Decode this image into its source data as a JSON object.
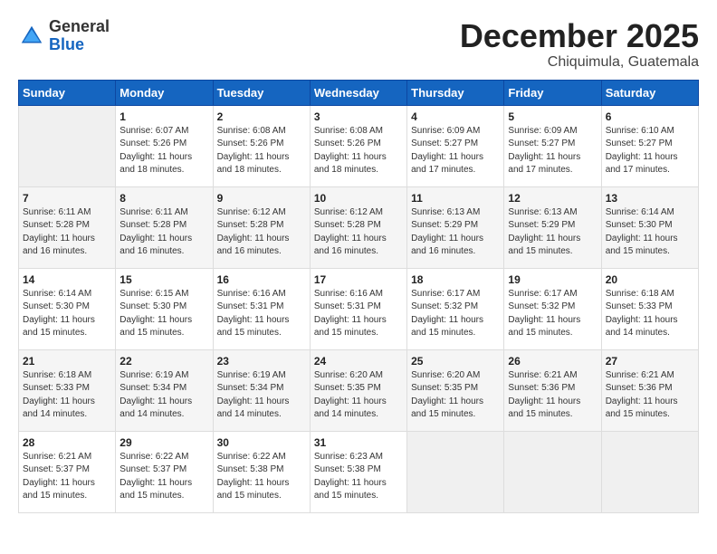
{
  "header": {
    "logo_general": "General",
    "logo_blue": "Blue",
    "month_title": "December 2025",
    "location": "Chiquimula, Guatemala"
  },
  "days_of_week": [
    "Sunday",
    "Monday",
    "Tuesday",
    "Wednesday",
    "Thursday",
    "Friday",
    "Saturday"
  ],
  "weeks": [
    [
      {
        "day": "",
        "empty": true
      },
      {
        "day": "1",
        "sunrise": "6:07 AM",
        "sunset": "5:26 PM",
        "daylight": "11 hours and 18 minutes."
      },
      {
        "day": "2",
        "sunrise": "6:08 AM",
        "sunset": "5:26 PM",
        "daylight": "11 hours and 18 minutes."
      },
      {
        "day": "3",
        "sunrise": "6:08 AM",
        "sunset": "5:26 PM",
        "daylight": "11 hours and 18 minutes."
      },
      {
        "day": "4",
        "sunrise": "6:09 AM",
        "sunset": "5:27 PM",
        "daylight": "11 hours and 17 minutes."
      },
      {
        "day": "5",
        "sunrise": "6:09 AM",
        "sunset": "5:27 PM",
        "daylight": "11 hours and 17 minutes."
      },
      {
        "day": "6",
        "sunrise": "6:10 AM",
        "sunset": "5:27 PM",
        "daylight": "11 hours and 17 minutes."
      }
    ],
    [
      {
        "day": "7",
        "sunrise": "6:11 AM",
        "sunset": "5:28 PM",
        "daylight": "11 hours and 16 minutes."
      },
      {
        "day": "8",
        "sunrise": "6:11 AM",
        "sunset": "5:28 PM",
        "daylight": "11 hours and 16 minutes."
      },
      {
        "day": "9",
        "sunrise": "6:12 AM",
        "sunset": "5:28 PM",
        "daylight": "11 hours and 16 minutes."
      },
      {
        "day": "10",
        "sunrise": "6:12 AM",
        "sunset": "5:28 PM",
        "daylight": "11 hours and 16 minutes."
      },
      {
        "day": "11",
        "sunrise": "6:13 AM",
        "sunset": "5:29 PM",
        "daylight": "11 hours and 16 minutes."
      },
      {
        "day": "12",
        "sunrise": "6:13 AM",
        "sunset": "5:29 PM",
        "daylight": "11 hours and 15 minutes."
      },
      {
        "day": "13",
        "sunrise": "6:14 AM",
        "sunset": "5:30 PM",
        "daylight": "11 hours and 15 minutes."
      }
    ],
    [
      {
        "day": "14",
        "sunrise": "6:14 AM",
        "sunset": "5:30 PM",
        "daylight": "11 hours and 15 minutes."
      },
      {
        "day": "15",
        "sunrise": "6:15 AM",
        "sunset": "5:30 PM",
        "daylight": "11 hours and 15 minutes."
      },
      {
        "day": "16",
        "sunrise": "6:16 AM",
        "sunset": "5:31 PM",
        "daylight": "11 hours and 15 minutes."
      },
      {
        "day": "17",
        "sunrise": "6:16 AM",
        "sunset": "5:31 PM",
        "daylight": "11 hours and 15 minutes."
      },
      {
        "day": "18",
        "sunrise": "6:17 AM",
        "sunset": "5:32 PM",
        "daylight": "11 hours and 15 minutes."
      },
      {
        "day": "19",
        "sunrise": "6:17 AM",
        "sunset": "5:32 PM",
        "daylight": "11 hours and 15 minutes."
      },
      {
        "day": "20",
        "sunrise": "6:18 AM",
        "sunset": "5:33 PM",
        "daylight": "11 hours and 14 minutes."
      }
    ],
    [
      {
        "day": "21",
        "sunrise": "6:18 AM",
        "sunset": "5:33 PM",
        "daylight": "11 hours and 14 minutes."
      },
      {
        "day": "22",
        "sunrise": "6:19 AM",
        "sunset": "5:34 PM",
        "daylight": "11 hours and 14 minutes."
      },
      {
        "day": "23",
        "sunrise": "6:19 AM",
        "sunset": "5:34 PM",
        "daylight": "11 hours and 14 minutes."
      },
      {
        "day": "24",
        "sunrise": "6:20 AM",
        "sunset": "5:35 PM",
        "daylight": "11 hours and 14 minutes."
      },
      {
        "day": "25",
        "sunrise": "6:20 AM",
        "sunset": "5:35 PM",
        "daylight": "11 hours and 15 minutes."
      },
      {
        "day": "26",
        "sunrise": "6:21 AM",
        "sunset": "5:36 PM",
        "daylight": "11 hours and 15 minutes."
      },
      {
        "day": "27",
        "sunrise": "6:21 AM",
        "sunset": "5:36 PM",
        "daylight": "11 hours and 15 minutes."
      }
    ],
    [
      {
        "day": "28",
        "sunrise": "6:21 AM",
        "sunset": "5:37 PM",
        "daylight": "11 hours and 15 minutes."
      },
      {
        "day": "29",
        "sunrise": "6:22 AM",
        "sunset": "5:37 PM",
        "daylight": "11 hours and 15 minutes."
      },
      {
        "day": "30",
        "sunrise": "6:22 AM",
        "sunset": "5:38 PM",
        "daylight": "11 hours and 15 minutes."
      },
      {
        "day": "31",
        "sunrise": "6:23 AM",
        "sunset": "5:38 PM",
        "daylight": "11 hours and 15 minutes."
      },
      {
        "day": "",
        "empty": true
      },
      {
        "day": "",
        "empty": true
      },
      {
        "day": "",
        "empty": true
      }
    ]
  ],
  "labels": {
    "sunrise_prefix": "Sunrise: ",
    "sunset_prefix": "Sunset: ",
    "daylight_prefix": "Daylight: "
  }
}
